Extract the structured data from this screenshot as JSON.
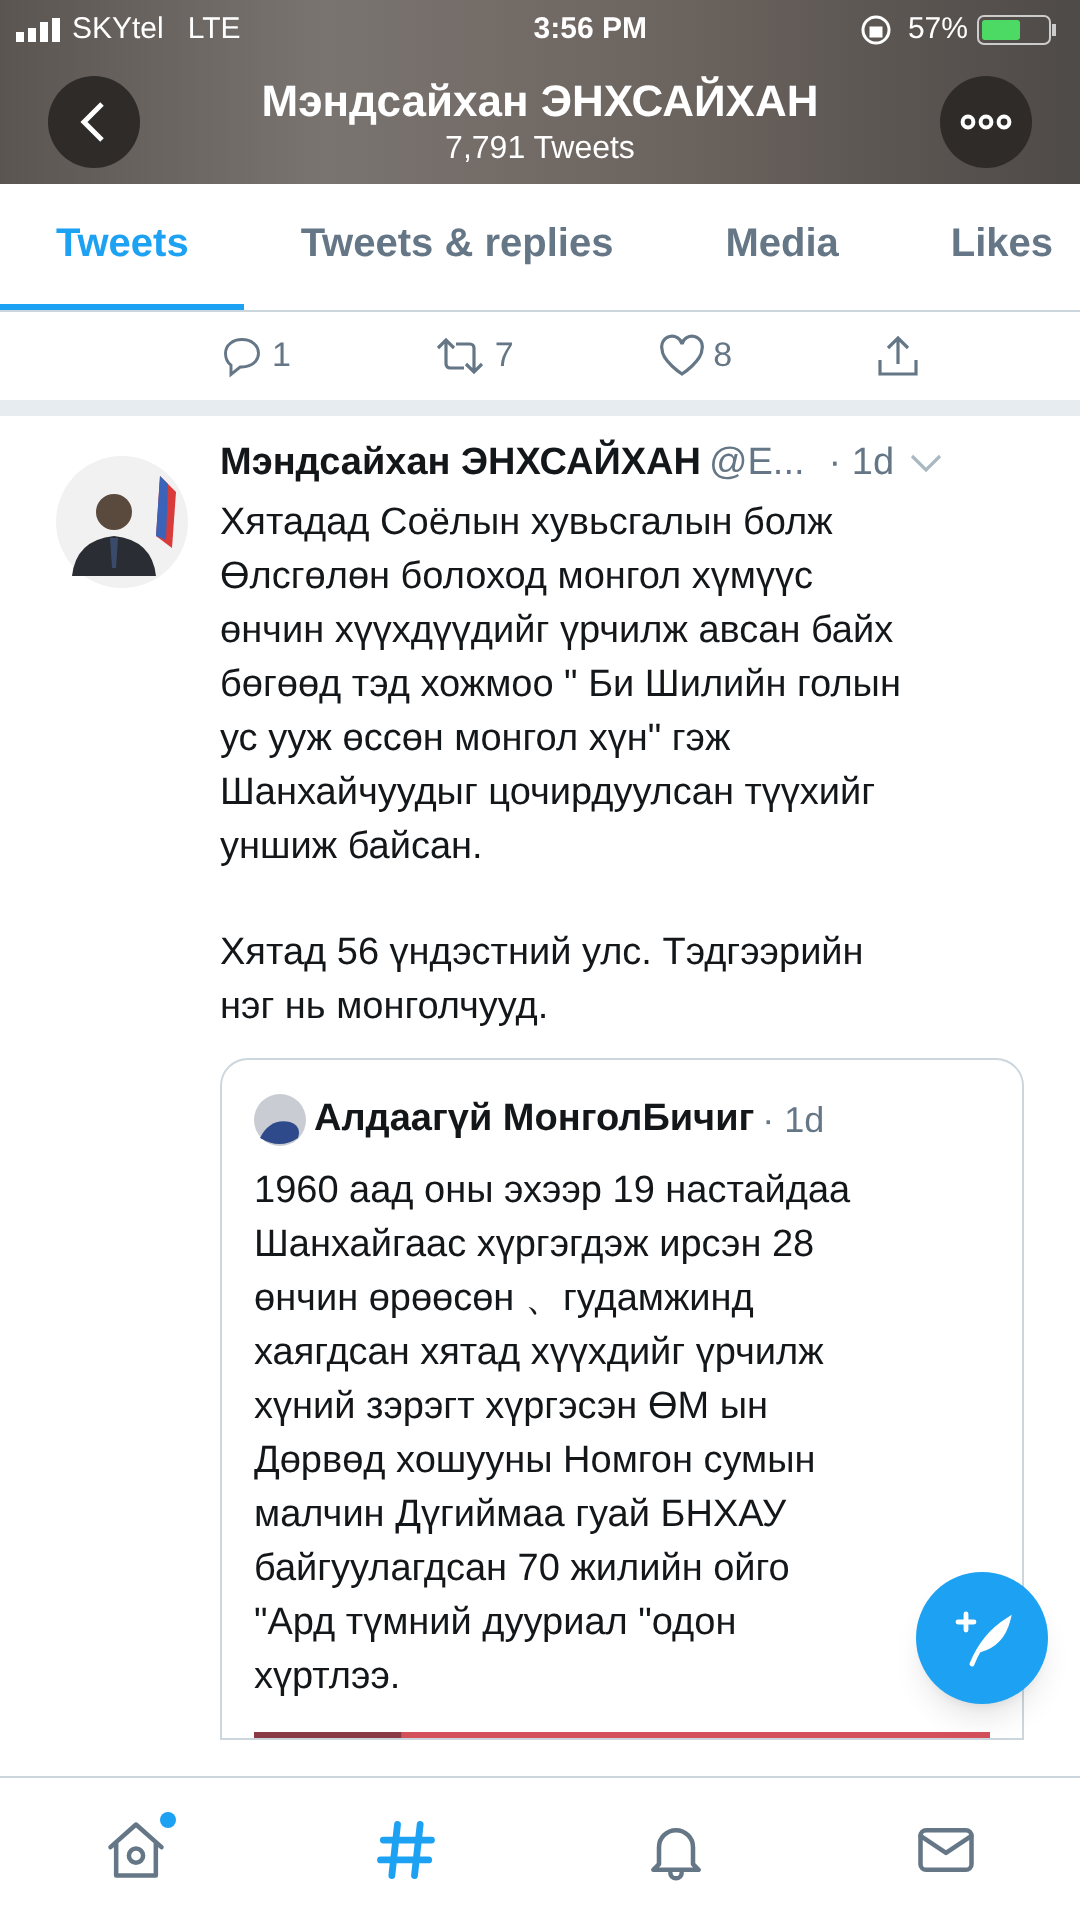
{
  "status_bar": {
    "carrier": "SKYtel",
    "network": "LTE",
    "time": "3:56 PM",
    "battery": "57%"
  },
  "header": {
    "title": "Мэндсайхан ЭНХСАЙХАН",
    "subtitle": "7,791 Tweets"
  },
  "tabs": [
    {
      "label": "Tweets",
      "selected": true
    },
    {
      "label": "Tweets & replies",
      "selected": false
    },
    {
      "label": "Media",
      "selected": false
    },
    {
      "label": "Likes",
      "selected": false
    }
  ],
  "previous_tweet_actions": {
    "replies": "1",
    "retweets": "7",
    "likes": "8"
  },
  "tweet": {
    "name": "Мэндсайхан ЭНХСАЙХАН",
    "handle": "@E...",
    "time": "· 1d",
    "paragraphs": [
      "Хятадад Соёлын хувьсгалын болж\nӨлсгөлөн болоход монгол хүмүүс\nөнчин хүүхдүүдийг үрчилж авсан байх\nбөгөөд тэд хожмоо \" Би Шилийн голын\nус ууж өссөн монгол хүн\" гэж\nШанхайчуудыг цочирдуулсан түүхийг\nуншиж байсан.",
      "Хятад 56 үндэстний улс. Тэдгээрийн\nнэг нь монголчууд."
    ],
    "quote": {
      "name": "Алдаагүй МонголБичиг",
      "time": "· 1d",
      "text": "1960 аад оны эхээр 19 настайдаа\nШанхайгаас хүргэгдэж ирсэн 28\nөнчин өрөөсөн 、гудамжинд\nхаягдсан хятад хүүхдийг үрчилж\nхүний зэрэгт хүргэсэн ӨМ ын\nДөрвөд хошууны Номгон сумын\nмалчин Дүгиймаа гуай БНХАУ\nбайгуулагдсан 70 жилийн ойго\n\"Ард түмний дууриал \"одон\nхүртлээ."
    }
  },
  "bottom_nav": [
    {
      "kind": "home",
      "selected": false,
      "badge": true
    },
    {
      "kind": "explore",
      "selected": true,
      "badge": false
    },
    {
      "kind": "notifications",
      "selected": false,
      "badge": false
    },
    {
      "kind": "messages",
      "selected": false,
      "badge": false
    }
  ]
}
